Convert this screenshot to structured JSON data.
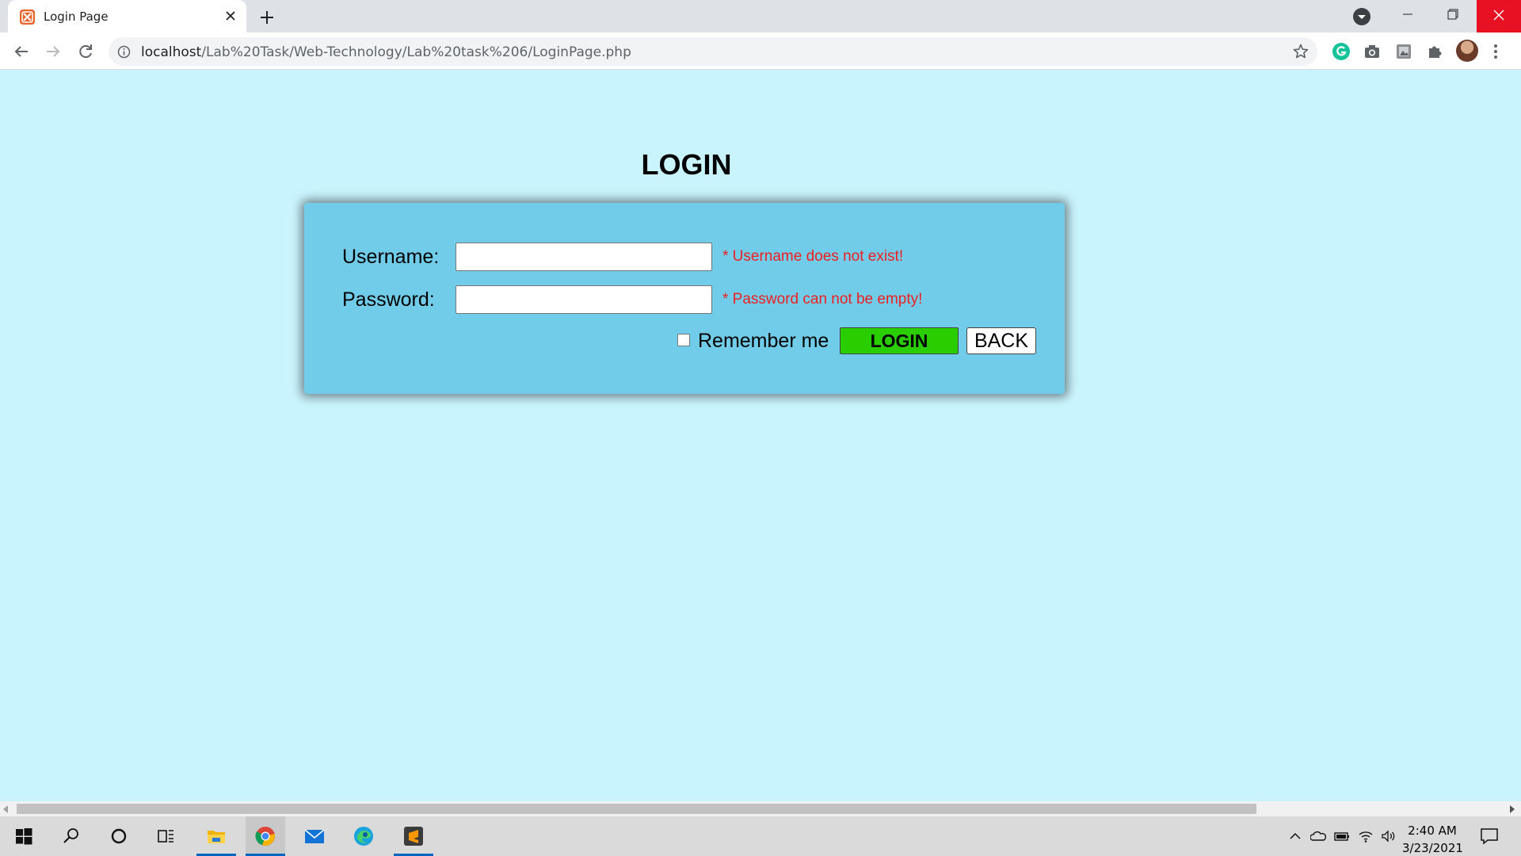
{
  "browser": {
    "tab": {
      "title": "Login Page",
      "favicon": "xampp-icon",
      "close_icon": "close-icon"
    },
    "new_tab_icon": "plus-icon",
    "address_bar": {
      "url_host": "localhost",
      "url_path": "/Lab%20Task/Web-Technology/Lab%20task%206/LoginPage.php"
    },
    "toolbar_icons": [
      "back-arrow-icon",
      "forward-arrow-icon",
      "reload-icon",
      "info-icon",
      "bookmark-star-icon",
      "grammarly-icon",
      "camera-icon",
      "photo-extension-icon",
      "extensions-puzzle-icon",
      "profile-avatar",
      "more-menu-icon"
    ],
    "window_controls": [
      "minimize-icon",
      "maximize-icon",
      "close-icon"
    ]
  },
  "page": {
    "title": "LOGIN",
    "form": {
      "username_label": "Username:",
      "username_value": "",
      "username_error": "* Username does not exist!",
      "password_label": "Password:",
      "password_value": "",
      "password_error": "* Password can not be empty!",
      "remember_label": "Remember me",
      "remember_checked": false,
      "login_button": "LOGIN",
      "back_button": "BACK"
    },
    "colors": {
      "page_background": "#c9f3fd",
      "card_background": "#71cce9",
      "error_text": "#ee1f1f",
      "login_button": "#29cd00"
    }
  },
  "taskbar": {
    "items": [
      "windows-start-icon",
      "search-icon",
      "cortana-icon",
      "task-view-icon",
      "file-explorer-icon",
      "chrome-icon",
      "mail-icon",
      "edge-icon",
      "sublime-text-icon"
    ],
    "tray": [
      "chevron-up-icon",
      "onedrive-icon",
      "battery-icon",
      "wifi-icon",
      "volume-icon"
    ],
    "time": "2:40 AM",
    "date": "3/23/2021"
  }
}
